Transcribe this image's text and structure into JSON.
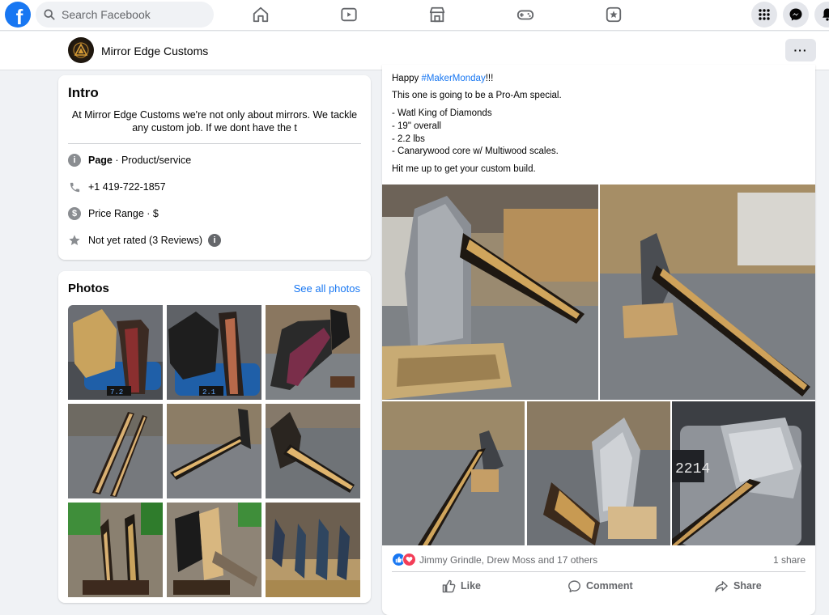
{
  "topbar": {
    "logo": "f",
    "search_placeholder": "Search Facebook",
    "nav_icons": [
      "home-icon",
      "watch-icon",
      "marketplace-icon",
      "gaming-icon",
      "news-icon"
    ],
    "right_icons": [
      "menu-grid-icon",
      "messenger-icon",
      "notifications-icon"
    ]
  },
  "page_header": {
    "name": "Mirror Edge Customs",
    "more_label": "···"
  },
  "intro": {
    "title": "Intro",
    "bio": "At Mirror Edge Customs we're not only about mirrors. We tackle any custom job. If we dont have the t",
    "category_label": "Page",
    "category_value": " · Product/service",
    "phone": "+1 419-722-1857",
    "price_range": "Price Range · $",
    "rating": "Not yet rated (3 Reviews)"
  },
  "photos": {
    "title": "Photos",
    "see_all": "See all photos",
    "scale_readout_1": "7.2",
    "scale_readout_2": "2.1"
  },
  "post": {
    "line1_prefix": "Happy ",
    "hashtag": "#MakerMonday",
    "line1_suffix": "!!!",
    "line2": "This one is going to be a Pro-Am special.",
    "bullets": [
      "- Watl King of Diamonds",
      "- 19\" overall",
      "- 2.2 lbs",
      "- Canarywood core w/ Multiwood scales."
    ],
    "line3": "Hit me up to get your custom build.",
    "scale_readout": "2214",
    "reactors": "Jimmy Grindle, Drew Moss and 17 others",
    "shares": "1 share",
    "actions": {
      "like": "Like",
      "comment": "Comment",
      "share": "Share"
    }
  },
  "colors": {
    "brand": "#1877f2",
    "background": "#f0f2f5",
    "secondary_text": "#65676b",
    "like_blue": "#1877f2",
    "love_red": "#f33e58"
  }
}
